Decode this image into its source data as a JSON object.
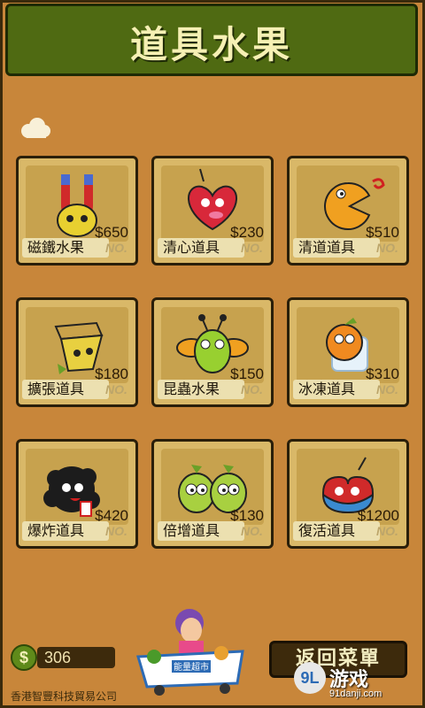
{
  "title": "道具水果",
  "items": [
    {
      "label": "磁鐵水果",
      "price": "$650",
      "status": "NO.",
      "icon": "magnet-fruit-icon",
      "color": "#e8d030"
    },
    {
      "label": "清心道具",
      "price": "$230",
      "status": "NO.",
      "icon": "heart-fruit-icon",
      "color": "#d8283a"
    },
    {
      "label": "清道道具",
      "price": "$510",
      "status": "NO.",
      "icon": "chomper-fruit-icon",
      "color": "#f0a020"
    },
    {
      "label": "擴張道具",
      "price": "$180",
      "status": "NO.",
      "icon": "box-fruit-icon",
      "color": "#e8d040"
    },
    {
      "label": "昆蟲水果",
      "price": "$150",
      "status": "NO.",
      "icon": "bug-fruit-icon",
      "color": "#98d030"
    },
    {
      "label": "冰凍道具",
      "price": "$310",
      "status": "NO.",
      "icon": "ice-fruit-icon",
      "color": "#f08a20"
    },
    {
      "label": "爆炸道具",
      "price": "$420",
      "status": "NO.",
      "icon": "bomb-fruit-icon",
      "color": "#222222"
    },
    {
      "label": "倍增道具",
      "price": "$130",
      "status": "NO.",
      "icon": "twin-fruit-icon",
      "color": "#a8d040"
    },
    {
      "label": "復活道具",
      "price": "$1200",
      "status": "NO.",
      "icon": "revive-fruit-icon",
      "color": "#3a8ad0"
    }
  ],
  "wallet": {
    "currency_symbol": "$",
    "coins": "306"
  },
  "back_button": "返回菜單",
  "mascot_sign": "能量超市",
  "company": "香港智豐科技貿易公司",
  "watermark": {
    "logo": "9L",
    "title": "游戏",
    "url": "91danji.com"
  },
  "colors": {
    "background": "#c8863a",
    "title_bar": "#4f6a12",
    "card": "#d9b868"
  }
}
